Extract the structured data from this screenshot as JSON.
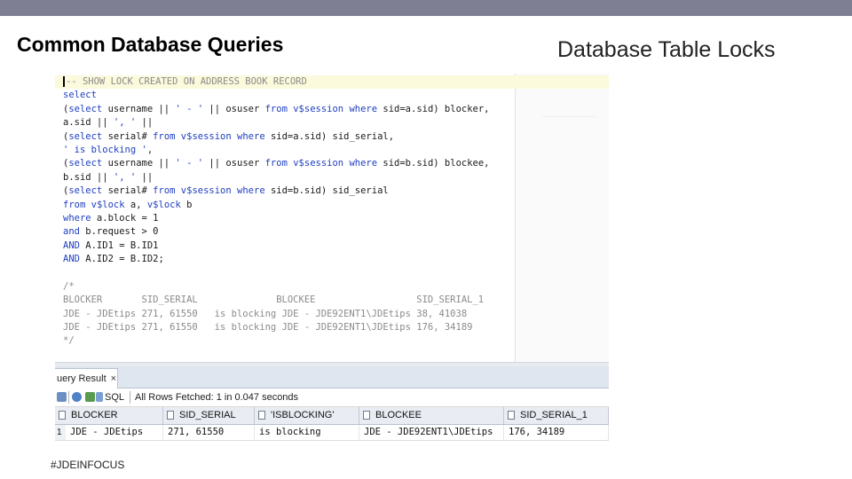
{
  "slide": {
    "title_left": "Common Database Queries",
    "title_right": "Database Table Locks",
    "footer": "#JDEINFOCUS",
    "accent_color": "#7f7f94"
  },
  "editor": {
    "lines": [
      "-- SHOW LOCK CREATED ON ADDRESS BOOK RECORD",
      "select",
      "(select username || ' - ' || osuser from v$session where sid=a.sid) blocker,",
      "a.sid || ', ' ||",
      "(select serial# from v$session where sid=a.sid) sid_serial,",
      "' is blocking ',",
      "(select username || ' - ' || osuser from v$session where sid=b.sid) blockee,",
      "b.sid || ', ' ||",
      "(select serial# from v$session where sid=b.sid) sid_serial",
      "from v$lock a, v$lock b",
      "where a.block = 1",
      "and b.request > 0",
      "AND A.ID1 = B.ID1",
      "AND A.ID2 = B.ID2;",
      "",
      "/*",
      "BLOCKER       SID_SERIAL              BLOCKEE                  SID_SERIAL_1",
      "JDE - JDEtips 271, 61550   is blocking JDE - JDE92ENT1\\JDEtips 38, 41038",
      "JDE - JDEtips 271, 61550   is blocking JDE - JDE92ENT1\\JDEtips 176, 34189",
      "*/"
    ]
  },
  "results": {
    "tab_label": "uery Result",
    "tab_close": "×",
    "toolbar_sql": "SQL",
    "toolbar_status": "All Rows Fetched: 1 in 0.047 seconds",
    "columns": [
      "BLOCKER",
      "SID_SERIAL",
      "'ISBLOCKING'",
      "BLOCKEE",
      "SID_SERIAL_1"
    ],
    "rows": [
      {
        "num": "1",
        "cells": [
          "JDE - JDEtips",
          "271, 61550",
          "is blocking",
          "JDE - JDE92ENT1\\JDEtips",
          "176, 34189"
        ]
      }
    ]
  }
}
